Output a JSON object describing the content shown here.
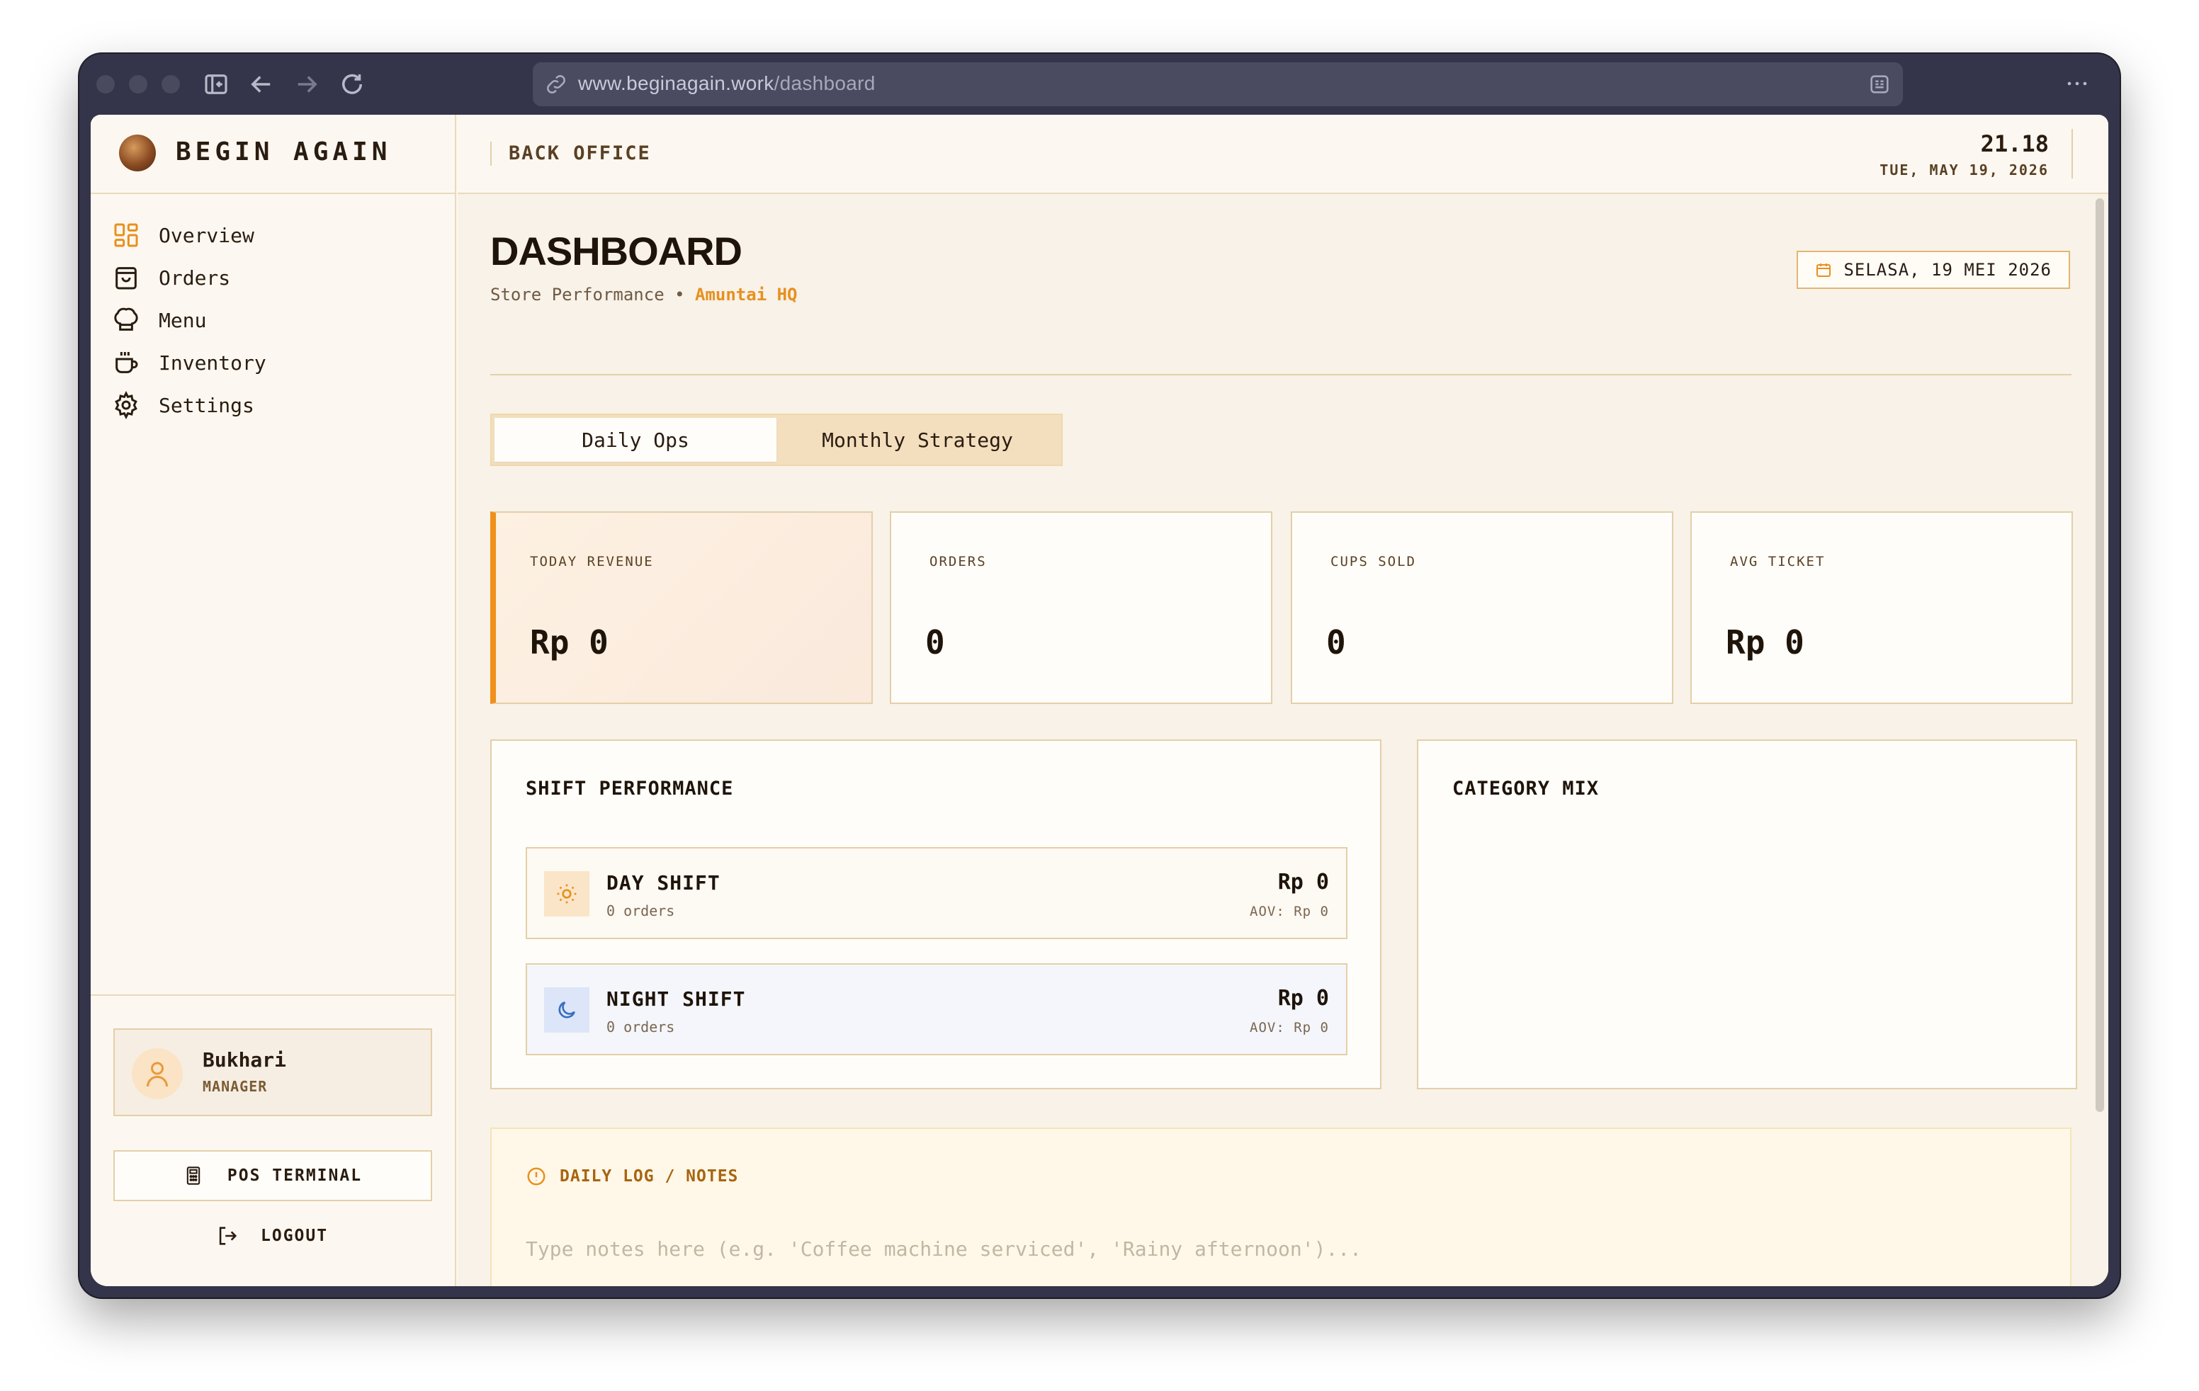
{
  "browser": {
    "url_host": "www.beginagain.work",
    "url_path": "/dashboard"
  },
  "sidebar": {
    "brand": "BEGIN AGAIN",
    "items": [
      {
        "label": "Overview",
        "icon": "grid-icon"
      },
      {
        "label": "Orders",
        "icon": "shopping-bag-icon"
      },
      {
        "label": "Menu",
        "icon": "chef-hat-icon"
      },
      {
        "label": "Inventory",
        "icon": "coffee-cup-icon"
      },
      {
        "label": "Settings",
        "icon": "gear-icon"
      }
    ],
    "user": {
      "name": "Bukhari",
      "role": "MANAGER"
    },
    "pos_label": "POS TERMINAL",
    "logout_label": "LOGOUT"
  },
  "topbar": {
    "section": "BACK OFFICE",
    "time": "21.18",
    "date": "TUE, MAY 19, 2026"
  },
  "header": {
    "title": "DASHBOARD",
    "subtitle": "Store Performance",
    "separator": "•",
    "location": "Amuntai HQ",
    "date_button": "SELASA, 19 MEI 2026"
  },
  "tabs": [
    {
      "label": "Daily Ops",
      "active": true
    },
    {
      "label": "Monthly Strategy",
      "active": false
    }
  ],
  "kpis": [
    {
      "label": "TODAY REVENUE",
      "value": "Rp 0"
    },
    {
      "label": "ORDERS",
      "value": "0"
    },
    {
      "label": "CUPS SOLD",
      "value": "0"
    },
    {
      "label": "AVG TICKET",
      "value": "Rp 0"
    }
  ],
  "shift_performance": {
    "title": "SHIFT PERFORMANCE",
    "shifts": [
      {
        "name": "DAY SHIFT",
        "orders": "0 orders",
        "value": "Rp 0",
        "aov": "AOV: Rp 0",
        "icon": "sun-icon"
      },
      {
        "name": "NIGHT SHIFT",
        "orders": "0 orders",
        "value": "Rp 0",
        "aov": "AOV: Rp 0",
        "icon": "moon-icon"
      }
    ]
  },
  "category_mix": {
    "title": "CATEGORY MIX"
  },
  "notes": {
    "title": "DAILY LOG / NOTES",
    "placeholder": "Type notes here (e.g. 'Coffee machine serviced', 'Rainy afternoon')..."
  },
  "colors": {
    "accent": "#f0901b",
    "background": "#f8f2e8",
    "border": "#e4cfa9",
    "text": "#1f140a"
  }
}
